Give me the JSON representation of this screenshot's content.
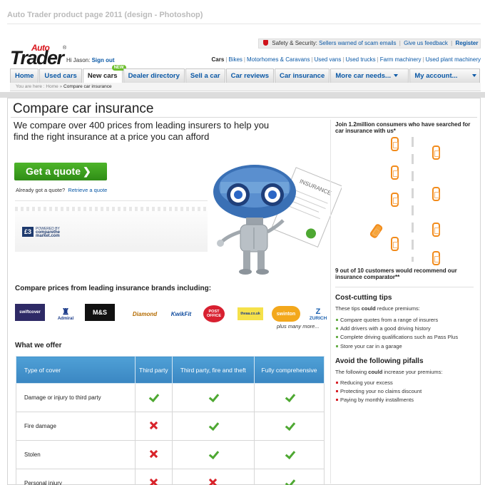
{
  "design_title": "Auto Trader product page 2011 (design - Photoshop)",
  "logo": {
    "auto": "Auto",
    "trader": "Trader",
    "reg": "®"
  },
  "user": {
    "greeting": "Hi Jason:",
    "signout": "Sign out"
  },
  "utility": {
    "safety_label": "Safety & Security:",
    "scam_link": "Sellers warned of scam emails",
    "feedback_link": "Give us feedback",
    "register_link": "Register"
  },
  "categories": [
    {
      "label": "Cars",
      "current": true
    },
    {
      "label": "Bikes"
    },
    {
      "label": "Motorhomes & Caravans"
    },
    {
      "label": "Used vans"
    },
    {
      "label": "Used trucks"
    },
    {
      "label": "Farm machinery"
    },
    {
      "label": "Used plant machinery"
    }
  ],
  "nav": {
    "home": "Home",
    "used_cars": "Used cars",
    "new_cars": "New cars",
    "new_badge": "NEW",
    "dealer_directory": "Dealer directory",
    "sell_a_car": "Sell a car",
    "car_reviews": "Car reviews",
    "car_insurance": "Car insurance",
    "more_car_needs": "More car needs...",
    "my_account": "My account..."
  },
  "breadcrumb": {
    "prefix": "You are here :",
    "home": "Home",
    "sep": "»",
    "current": "Compare car insurance"
  },
  "page": {
    "title": "Compare car insurance",
    "intro": "We compare over 400 prices from leading insurers to help you find the right insurance at a price you can afford",
    "quote_button": "Get a quote",
    "already_text": "Already got a quote?",
    "retrieve_link": "Retrieve a quote",
    "ctm": {
      "pound": "£3",
      "line1": "POWERED BY",
      "line2": "comparethe",
      "line3": "market.com"
    },
    "insurance_doc": "INSURANCE"
  },
  "brands": {
    "heading": "Compare prices from leading insurance brands including:",
    "items": {
      "swiftcover": "swiftcover",
      "admiral": "Admiral",
      "mands": "M&S",
      "diamond": "Diamond",
      "kwikfit": "KwikFit",
      "postoffice": "POST OFFICE",
      "shop": "theaa.co.uk",
      "swinton": "swinton",
      "zurich": "ZURICH"
    },
    "more": "plus many more..."
  },
  "offer": {
    "heading": "What we offer",
    "columns": [
      "Type of cover",
      "Third party",
      "Third party, fire and theft",
      "Fully comprehensive"
    ],
    "rows": [
      {
        "label": "Damage or injury to third party",
        "values": [
          true,
          true,
          true
        ]
      },
      {
        "label": "Fire damage",
        "values": [
          false,
          true,
          true
        ]
      },
      {
        "label": "Stolen",
        "values": [
          false,
          true,
          true
        ]
      },
      {
        "label": "Personal injury",
        "values": [
          false,
          false,
          true
        ]
      }
    ]
  },
  "sidebar": {
    "join": "Join 1.2million consumers who have searched for car insurance with us*",
    "recommend": "9 out of 10 customers would recommend our insurance comparator**",
    "tips_heading": "Cost-cutting tips",
    "tips_sub_pre": "These tips",
    "tips_sub_bold": "could",
    "tips_sub_post": "reduce premiums:",
    "tips": [
      "Compare quotes from a range of insurers",
      "Add drivers with a good driving history",
      "Complete driving qualifications such as Pass Plus",
      "Store your car in a garage"
    ],
    "pitfalls_heading": "Avoid the following pifalls",
    "pitfalls_sub_pre": "The following",
    "pitfalls_sub_bold": "could",
    "pitfalls_sub_post": "increase your premiums:",
    "pitfalls": [
      "Reducing your excess",
      "Protecting your no claims discount",
      "Paying by monthly installments"
    ]
  },
  "colors": {
    "accent_blue": "#0a58a6",
    "brand_red": "#d8121a",
    "quote_green": "#3a9e1e",
    "table_header": "#4297cf"
  }
}
